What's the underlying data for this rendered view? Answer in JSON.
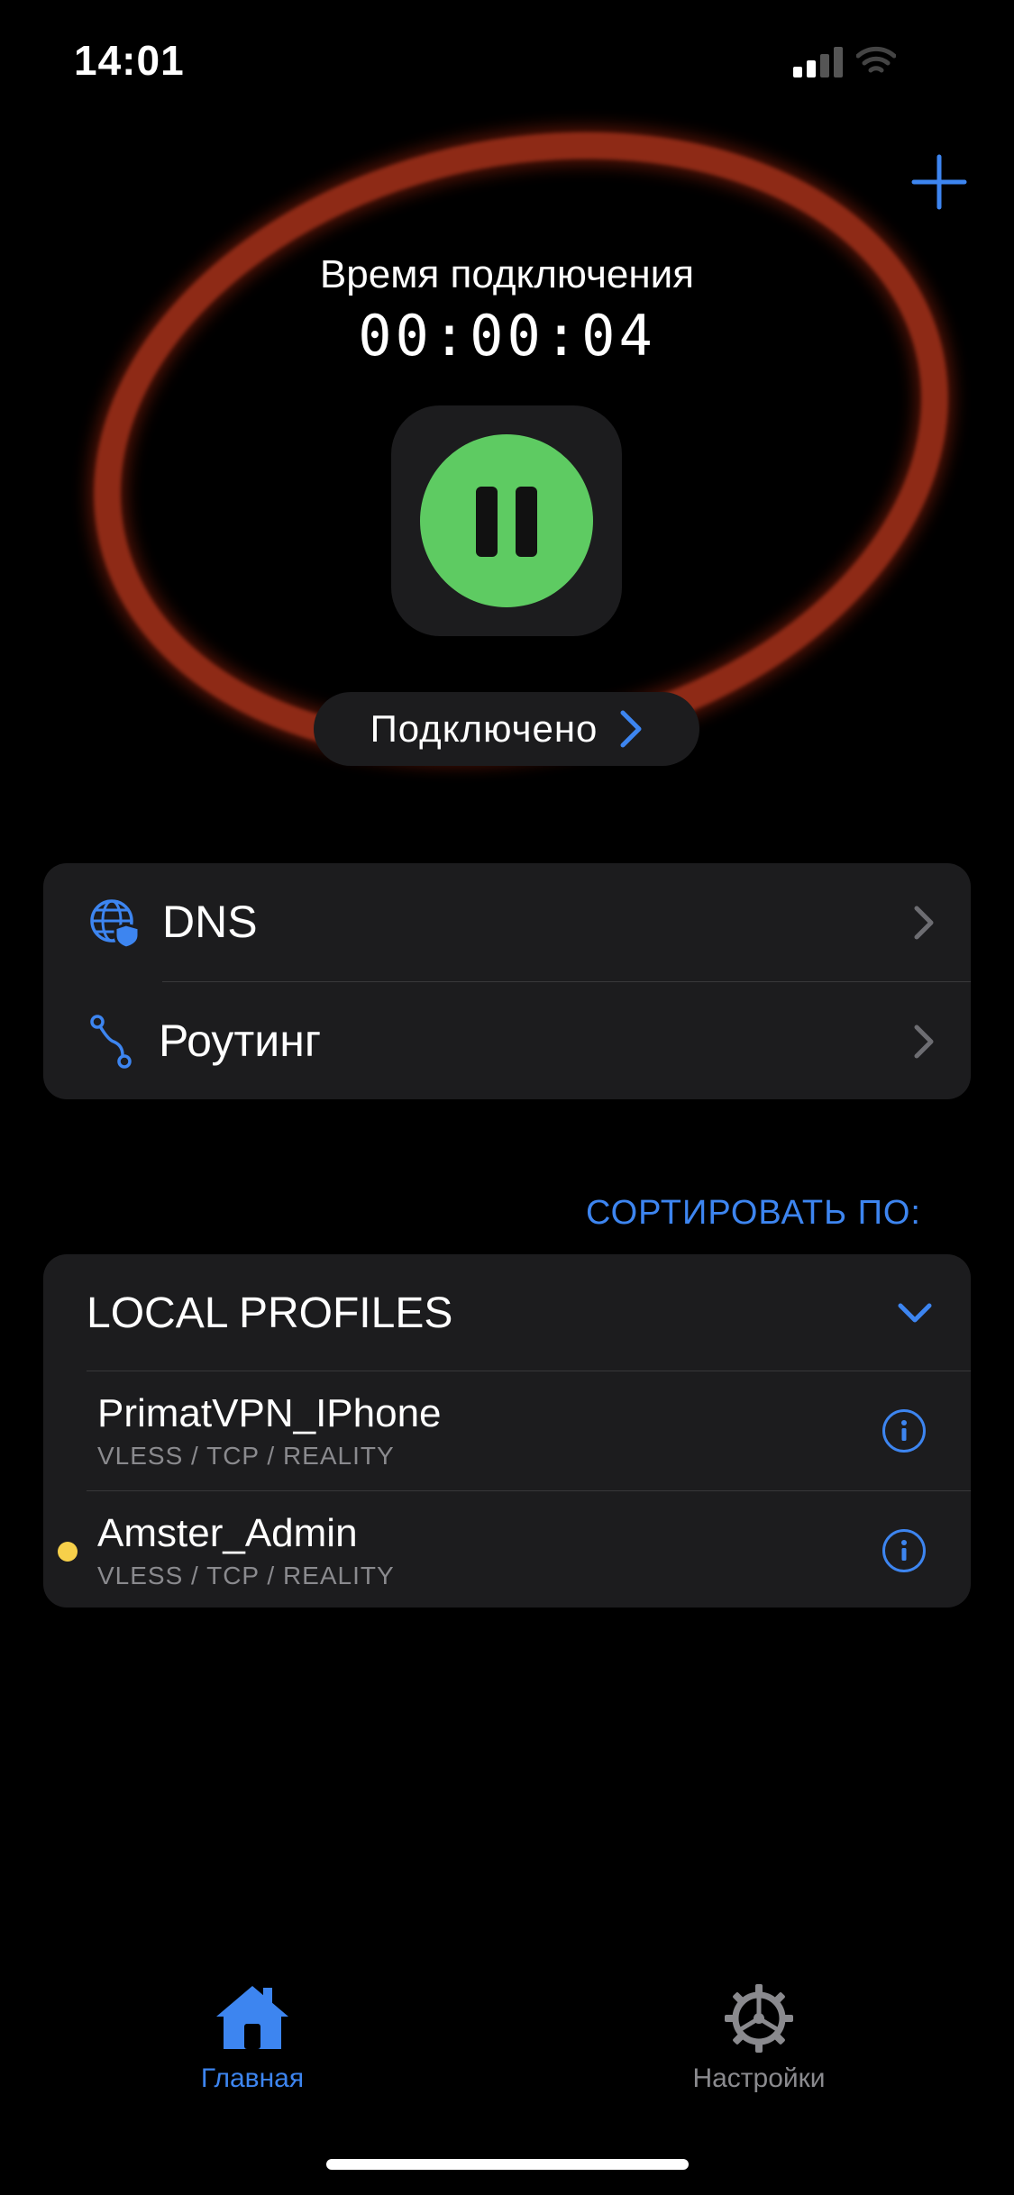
{
  "status_bar": {
    "time": "14:01"
  },
  "colors": {
    "accent": "#3d85f0",
    "connected_green": "#5ecb62",
    "ring_red": "#8e2a16",
    "active_dot": "#f7d04a"
  },
  "connection": {
    "label": "Время подключения",
    "elapsed": "00:00:04",
    "status": "Подключено"
  },
  "settings": [
    {
      "label": "DNS",
      "icon": "globe-shield-icon"
    },
    {
      "label": "Роутинг",
      "icon": "route-icon"
    }
  ],
  "sort": {
    "label": "СОРТИРОВАТЬ ПО:"
  },
  "profiles_group": {
    "title": "LOCAL PROFILES",
    "items": [
      {
        "name": "PrimatVPN_IPhone",
        "details": "VLESS / TCP / REALITY",
        "active": false
      },
      {
        "name": "Amster_Admin",
        "details": "VLESS / TCP / REALITY",
        "active": true
      }
    ]
  },
  "tabs": [
    {
      "label": "Главная",
      "icon": "house-icon",
      "selected": true
    },
    {
      "label": "Настройки",
      "icon": "gear-icon",
      "selected": false
    }
  ]
}
